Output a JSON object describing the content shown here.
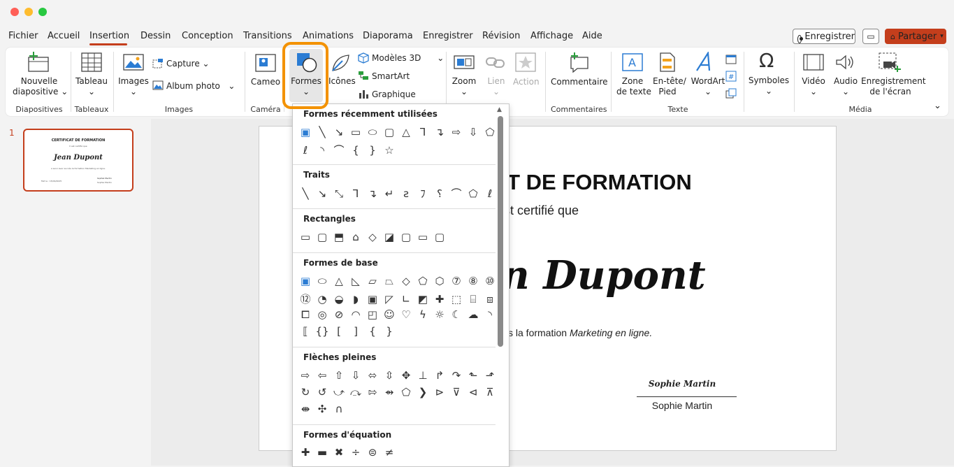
{
  "menu": {
    "tabs": [
      "Fichier",
      "Accueil",
      "Insertion",
      "Dessin",
      "Conception",
      "Transitions",
      "Animations",
      "Diaporama",
      "Enregistrer",
      "Révision",
      "Affichage",
      "Aide"
    ],
    "record_label": "Enregistrer",
    "share_label": "Partager"
  },
  "ribbon": {
    "new_slide": [
      "Nouvelle",
      "diapositive"
    ],
    "table": "Tableau",
    "images": "Images",
    "capture": "Capture",
    "photo_album": "Album photo",
    "cameo": "Cameo",
    "shapes": "Formes",
    "icons": "Icônes",
    "models3d": "Modèles 3D",
    "smartart": "SmartArt",
    "chart": "Graphique",
    "zoom": "Zoom",
    "link": "Lien",
    "action": "Action",
    "comment": "Commentaire",
    "textbox": [
      "Zone",
      "de texte"
    ],
    "header_footer": [
      "En-tête/",
      "Pied"
    ],
    "wordart": "WordArt",
    "symbols": "Symboles",
    "video": "Vidéo",
    "audio": "Audio",
    "screen_recording": [
      "Enregistrement",
      "de l'écran"
    ],
    "groups": {
      "slides": "Diapositives",
      "tables": "Tableaux",
      "images": "Images",
      "camera": "Caméra",
      "comments": "Commentaires",
      "text": "Texte",
      "media": "Média"
    }
  },
  "thumbnail": {
    "number": "1",
    "title": "CERTIFICAT DE FORMATION",
    "sub": "Il est certifié que",
    "name": "Jean Dupont",
    "desc": "a suivi avec succès la formation Marketing en ligne.",
    "date": "Fait le : 15/04/2025",
    "sign": "Sophie Martin"
  },
  "slide": {
    "title_visible": "AT DE FORMATION",
    "subtitle_visible": "est certifié que",
    "name_visible": "n Dupont",
    "desc_visible": "s la formation ",
    "desc_italic": "Marketing en ligne.",
    "signature": "Sophie Martin",
    "signer": "Sophie Martin"
  },
  "shapes_dropdown": {
    "recent": "Formes récemment utilisées",
    "lines": "Traits",
    "rectangles": "Rectangles",
    "basic": "Formes de base",
    "arrows": "Flèches pleines",
    "equation": "Formes d'équation"
  },
  "colors": {
    "accent": "#c43e1c",
    "highlight": "#f39200",
    "blue": "#2b7cd3"
  }
}
